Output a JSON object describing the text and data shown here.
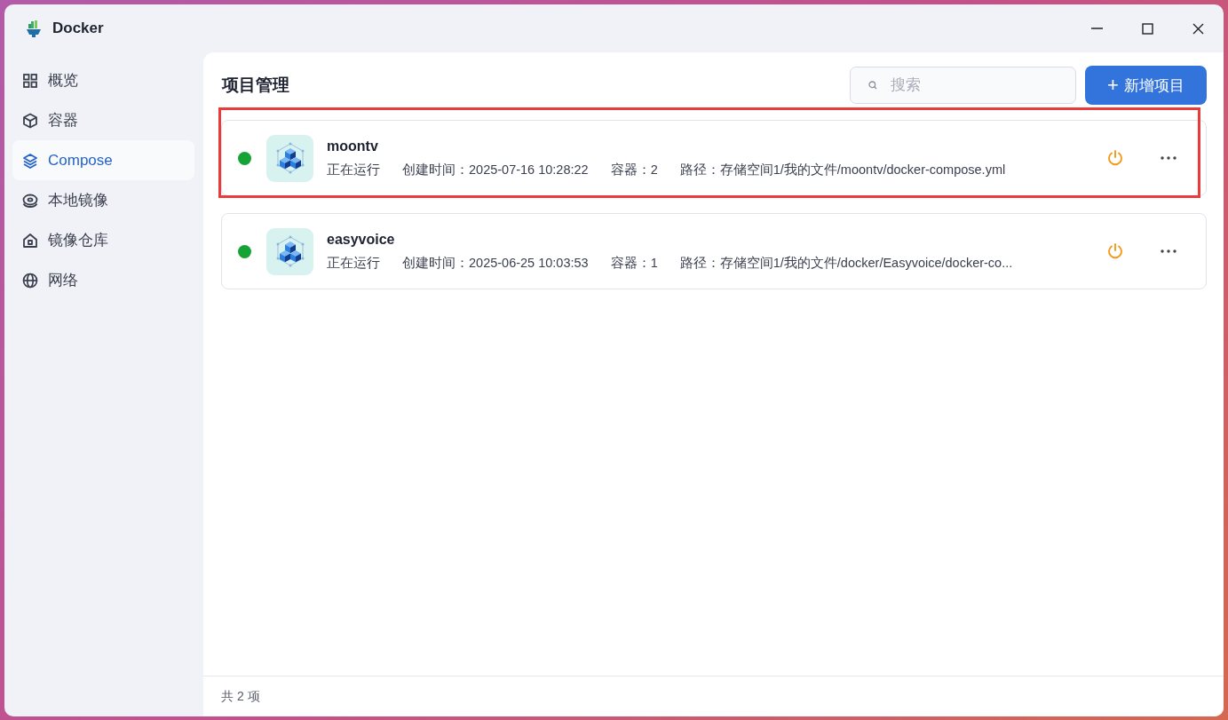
{
  "window": {
    "title": "Docker"
  },
  "sidebar": {
    "items": [
      {
        "label": "概览",
        "selected": false
      },
      {
        "label": "容器",
        "selected": false
      },
      {
        "label": "Compose",
        "selected": true
      },
      {
        "label": "本地镜像",
        "selected": false
      },
      {
        "label": "镜像仓库",
        "selected": false
      },
      {
        "label": "网络",
        "selected": false
      }
    ]
  },
  "header": {
    "title": "项目管理",
    "search": {
      "placeholder": "搜索"
    },
    "add_button": {
      "icon": "+",
      "label": "新增项目"
    }
  },
  "projects": [
    {
      "name": "moontv",
      "color": "#16a336",
      "status": "正在运行",
      "created": "创建时间：2025-07-16 10:28:22",
      "containers": "容器：2",
      "path": "路径：存储空间1/我的文件/moontv/docker-compose.yml",
      "highlighted": true
    },
    {
      "name": "easyvoice",
      "color": "#16a336",
      "status": "正在运行",
      "created": "创建时间：2025-06-25 10:03:53",
      "containers": "容器：1",
      "path": "路径：存储空间1/我的文件/docker/Easyvoice/docker-co...",
      "highlighted": false
    }
  ],
  "footer": {
    "count": "共 2 项"
  }
}
